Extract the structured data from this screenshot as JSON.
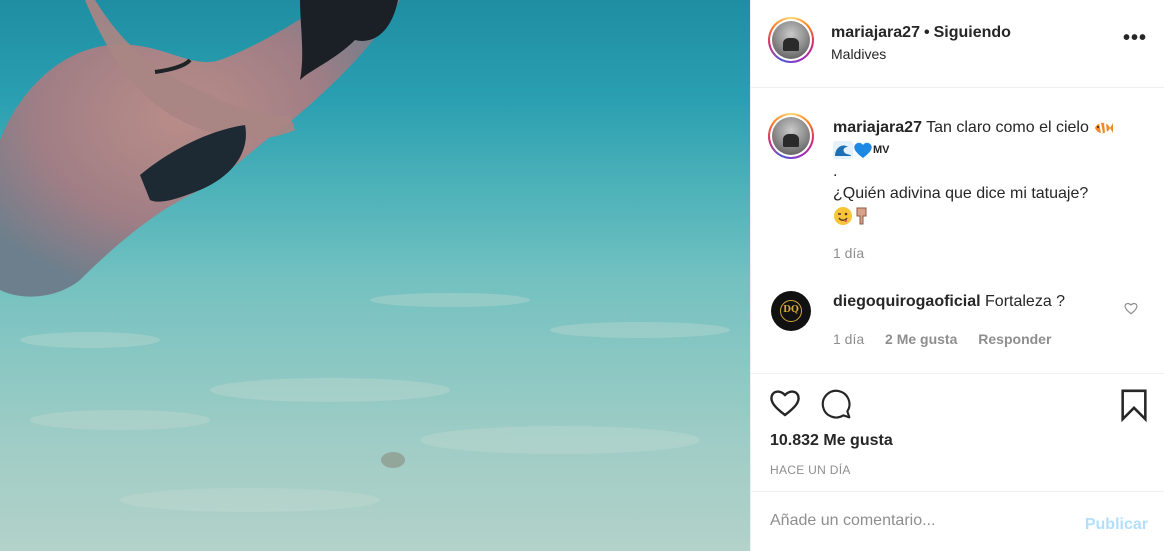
{
  "post": {
    "username": "mariajara27",
    "separator": "•",
    "follow_status": "Siguiendo",
    "location": "Maldives",
    "more_icon": "•••"
  },
  "caption": {
    "username": "mariajara27",
    "line1": "Tan claro como el cielo",
    "line2_suffix": "MV",
    "line3": ".",
    "line4": "¿Quién adivina que dice mi tatuaje?",
    "time": "1 día"
  },
  "comment": {
    "username": "diegoquirogaoficial",
    "text": "Fortaleza ?",
    "avatar_text": "DQ",
    "time": "1 día",
    "likes": "2 Me gusta",
    "reply": "Responder"
  },
  "actions": {
    "likes": "10.832 Me gusta",
    "posted_ago": "HACE UN DÍA"
  },
  "composer": {
    "placeholder": "Añade un comentario...",
    "publish": "Publicar"
  },
  "colors": {
    "publish_disabled": "#b2dffc",
    "secondary_text": "#8e8e8e",
    "water": "#4db2b9"
  },
  "icons": [
    "more-options-icon",
    "fish-emoji",
    "wave-emoji",
    "blue-heart-emoji",
    "winking-face-emoji",
    "pointing-down-emoji",
    "heart-icon",
    "comment-icon",
    "bookmark-icon"
  ]
}
